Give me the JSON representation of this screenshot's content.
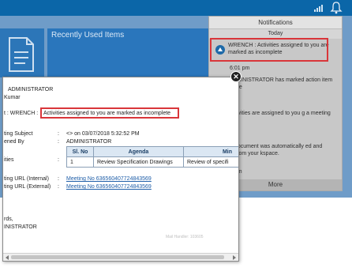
{
  "dashboard": {
    "recent_title": "Recently Used Items"
  },
  "notifications": {
    "header": "Notifications",
    "today_label": "Today",
    "items": [
      {
        "text": "WRENCH : Activities assigned to you are marked as incomplete",
        "time": "6:01 pm"
      },
      {
        "text": "NCH : ADMINISTRATOR has marked action item as complete"
      },
      {
        "text": "NCH : Activities are assigned to you g a meeting"
      },
      {
        "text": "NCH : A Document was automatically ed and removed from your kspace.",
        "time": "2 am"
      }
    ],
    "more_label": "More"
  },
  "modal": {
    "from_name": "ADMINISTRATOR",
    "to_name": "Kumar",
    "subject_prefix": "t : WRENCH :",
    "subject_text": "Activities assigned to you are marked as incomplete",
    "meeting_subject_label": "ting Subject",
    "meeting_subject_value": "<> on 03/07/2018 5:32:52 PM",
    "opened_by_label": "ened By",
    "opened_by_value": "ADMINISTRATOR",
    "activities_label": "ities",
    "agenda_table": {
      "columns": [
        "Sl. No",
        "Agenda",
        "Min"
      ],
      "rows": [
        [
          "1",
          "Review Specification Drawings",
          "Review of specifi"
        ]
      ]
    },
    "url_internal_label": "ting URL (Internal)",
    "url_internal_value": "Meeting No 636560407724843569",
    "url_external_label": "ting URL (External)",
    "url_external_value": "Meeting No 636560407724843569",
    "regards": "rds,",
    "signature": "INISTRATOR",
    "footer_faint": "Mail Handler: 103605",
    "separator": ":"
  }
}
